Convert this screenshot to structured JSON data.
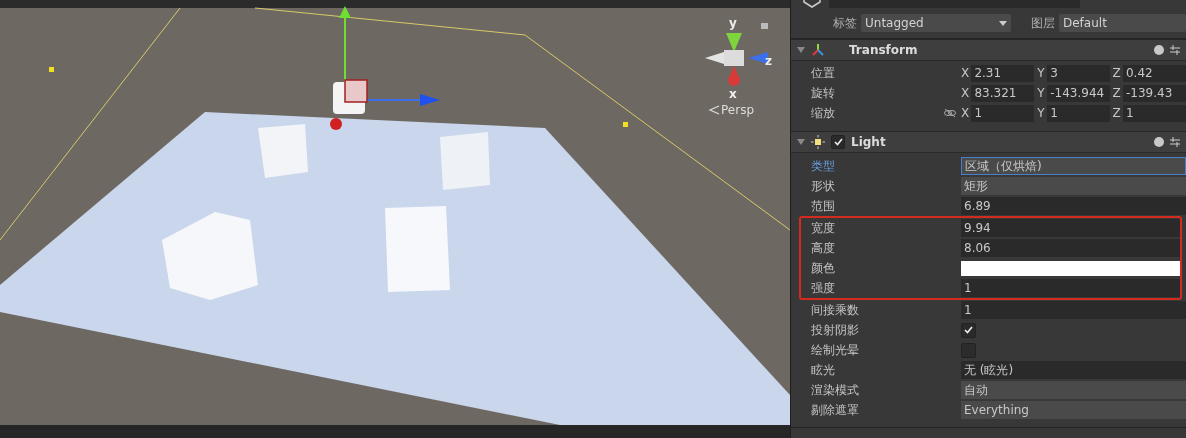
{
  "scene": {
    "axis_labels": [
      {
        "axis": "y"
      },
      {
        "axis": "z"
      },
      {
        "axis": "x"
      }
    ],
    "view_mode": "Persp"
  },
  "inspector": {
    "tag_label": "标签",
    "tag": "Untagged",
    "layer_label": "图层",
    "layer": "Default",
    "transform": {
      "title": "Transform",
      "rows": [
        {
          "label": "位置",
          "constrain_toggle": false,
          "values": [
            {
              "axis": "X",
              "value": "2.31"
            },
            {
              "axis": "Y",
              "value": "3"
            },
            {
              "axis": "Z",
              "value": "0.42"
            }
          ]
        },
        {
          "label": "旋转",
          "constrain_toggle": false,
          "values": [
            {
              "axis": "X",
              "value": "83.321"
            },
            {
              "axis": "Y",
              "value": "-143.944"
            },
            {
              "axis": "Z",
              "value": "-139.43"
            }
          ]
        },
        {
          "label": "缩放",
          "constrain_toggle": true,
          "values": [
            {
              "axis": "X",
              "value": "1"
            },
            {
              "axis": "Y",
              "value": "1"
            },
            {
              "axis": "Z",
              "value": "1"
            }
          ]
        }
      ]
    },
    "light": {
      "title": "Light",
      "enabled": true,
      "properties": [
        {
          "label": "类型",
          "kind": "dropdown",
          "value": "区域（仅烘焙)",
          "focused": true,
          "highlighted": false
        },
        {
          "label": "形状",
          "kind": "dropdown",
          "value": "矩形",
          "focused": false,
          "highlighted": false
        },
        {
          "label": "范围",
          "kind": "field",
          "value": "6.89",
          "focused": false,
          "highlighted": false
        },
        {
          "label": "宽度",
          "kind": "field",
          "value": "9.94",
          "focused": false,
          "highlighted": true
        },
        {
          "label": "高度",
          "kind": "field",
          "value": "8.06",
          "focused": false,
          "highlighted": true
        },
        {
          "label": "颜色",
          "kind": "color",
          "color": "#ffffff",
          "focused": false,
          "highlighted": true
        },
        {
          "label": "强度",
          "kind": "field",
          "value": "1",
          "focused": false,
          "highlighted": true
        },
        {
          "label": "间接乘数",
          "kind": "field",
          "value": "1",
          "focused": false,
          "highlighted": false
        },
        {
          "label": "投射阴影",
          "kind": "checkbox",
          "checked": true,
          "focused": false,
          "highlighted": false
        },
        {
          "label": "绘制光晕",
          "kind": "checkbox",
          "checked": false,
          "focused": false,
          "highlighted": false
        },
        {
          "label": "眩光",
          "kind": "field",
          "value": "无 (眩光)",
          "focused": false,
          "highlighted": false
        },
        {
          "label": "渲染模式",
          "kind": "dropdown",
          "value": "自动",
          "focused": false,
          "highlighted": false
        },
        {
          "label": "剔除遮罩",
          "kind": "dropdown",
          "value": "Everything",
          "focused": false,
          "highlighted": false
        }
      ]
    }
  }
}
